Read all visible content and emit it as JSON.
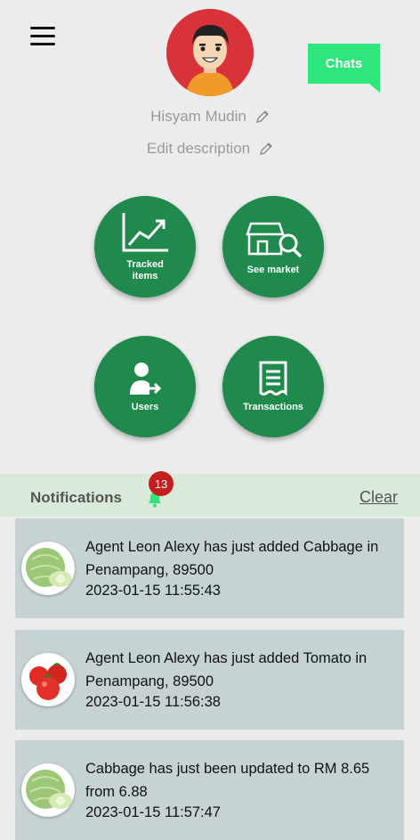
{
  "header": {
    "chats_label": "Chats",
    "profile_name": "Hisyam Mudin",
    "description_placeholder": "Edit description"
  },
  "tiles": [
    {
      "label": "Tracked items",
      "icon": "chart-trend-icon"
    },
    {
      "label": "See market",
      "icon": "market-search-icon"
    },
    {
      "label": "Users",
      "icon": "user-transfer-icon"
    },
    {
      "label": "Transactions",
      "icon": "receipt-icon"
    }
  ],
  "notifications": {
    "title": "Notifications",
    "count": "13",
    "clear_label": "Clear",
    "items": [
      {
        "message": "Agent Leon Alexy has just added Cabbage in Penampang, 89500",
        "time": "2023-01-15 11:55:43",
        "thumb": "cabbage"
      },
      {
        "message": "Agent Leon Alexy has just added Tomato in Penampang, 89500",
        "time": "2023-01-15 11:56:38",
        "thumb": "tomato"
      },
      {
        "message": "Cabbage has just been updated to RM 8.65 from 6.88",
        "time": "2023-01-15 11:57:47",
        "thumb": "cabbage"
      }
    ]
  },
  "colors": {
    "accent_green": "#1f8a4c",
    "chats_green": "#2ee67c",
    "badge_red": "#c41e1e",
    "card_bg": "#c7d2d5",
    "notif_bar_bg": "#d9eadb"
  }
}
